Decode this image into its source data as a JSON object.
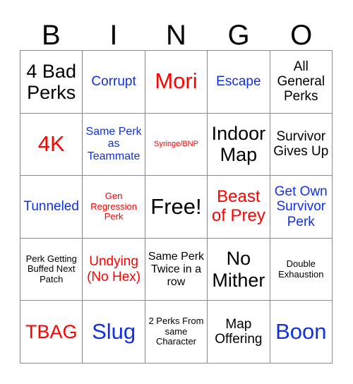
{
  "card": {
    "title": "BINGO",
    "headers": [
      "B",
      "I",
      "N",
      "G",
      "O"
    ],
    "colors": {
      "black": "#000000",
      "red": "#ff0000",
      "blue": "#1130e4",
      "grid_line": "#8a8a8a",
      "background": "#ffffff"
    },
    "rows": [
      [
        {
          "text": "4 Bad Perks",
          "color": "black",
          "size": "xl"
        },
        {
          "text": "Corrupt",
          "color": "blue",
          "size": "md"
        },
        {
          "text": "Mori",
          "color": "red",
          "size": "xxl"
        },
        {
          "text": "Escape",
          "color": "blue",
          "size": "md"
        },
        {
          "text": "All General Perks",
          "color": "black",
          "size": "md"
        }
      ],
      [
        {
          "text": "4K",
          "color": "red",
          "size": "xxl"
        },
        {
          "text": "Same Perk as Teammate",
          "color": "blue",
          "size": "sm"
        },
        {
          "text": "Syringe/BNP",
          "color": "red",
          "size": "xxs"
        },
        {
          "text": "Indoor Map",
          "color": "black",
          "size": "xl"
        },
        {
          "text": "Survivor Gives Up",
          "color": "black",
          "size": "md"
        }
      ],
      [
        {
          "text": "Tunneled",
          "color": "blue",
          "size": "md"
        },
        {
          "text": "Gen Regression Perk",
          "color": "red",
          "size": "xs"
        },
        {
          "text": "Free!",
          "color": "black",
          "size": "xxl"
        },
        {
          "text": "Beast of Prey",
          "color": "red",
          "size": "lg"
        },
        {
          "text": "Get Own Survivor Perk",
          "color": "blue",
          "size": "md"
        }
      ],
      [
        {
          "text": "Perk Getting Buffed Next Patch",
          "color": "black",
          "size": "xs"
        },
        {
          "text": "Undying (No Hex)",
          "color": "red",
          "size": "md"
        },
        {
          "text": "Same Perk Twice in a row",
          "color": "black",
          "size": "sm"
        },
        {
          "text": "No Mither",
          "color": "black",
          "size": "xl"
        },
        {
          "text": "Double Exhaustion",
          "color": "black",
          "size": "xs"
        }
      ],
      [
        {
          "text": "TBAG",
          "color": "red",
          "size": "xl"
        },
        {
          "text": "Slug",
          "color": "blue",
          "size": "xxl"
        },
        {
          "text": "2 Perks From same Character",
          "color": "black",
          "size": "xs"
        },
        {
          "text": "Map Offering",
          "color": "black",
          "size": "md"
        },
        {
          "text": "Boon",
          "color": "blue",
          "size": "xxl"
        }
      ]
    ]
  }
}
